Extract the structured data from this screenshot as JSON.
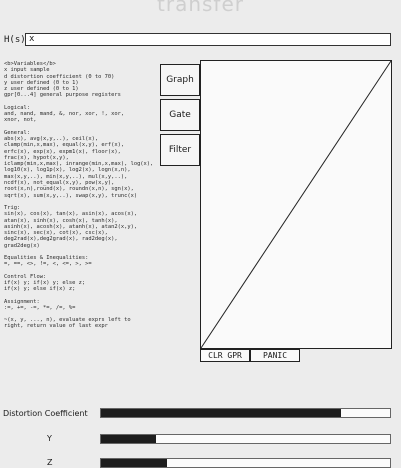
{
  "app": {
    "title": "transfer"
  },
  "expression": {
    "label": "H(s)=",
    "value": "x"
  },
  "docs": [
    {
      "lines": [
        "<b>Variables</b>",
        "x  input sample",
        "d  distortion coefficient (0 to 70)",
        "y  user defined (0 to 1)",
        "z  user defined (0 to 1)",
        "gpr[0...4]  general purpose registers"
      ]
    },
    {
      "lines": [
        "Logical:",
        "and, nand, mand, &, nor, xor, !, xor,",
        "xnor, not,"
      ]
    },
    {
      "lines": [
        "General:",
        "abs(x), avg(x,y,..), ceil(x),",
        "clamp(min,x,max), equal(x,y), erf(x),",
        "erfc(x), exp(x), expm1(x), floor(x),",
        "frac(x), hypot(x,y),",
        "iclamp(min,x,max), inrange(min,x,max), log(x),",
        "log10(x), log1p(x), log2(x), logn(x,n),",
        "max(x,y,..), min(x,y,..), mul(x,y,..),",
        "ncdf(x), not_equal(x,y), pow(x,y),",
        "root(x,n),round(x), roundn(x,n), sgn(x),",
        "sqrt(x), sum(x,y,..), swap(x,y), trunc(x)"
      ]
    },
    {
      "lines": [
        "Trig:",
        "sin(x), cos(x), tan(x), asin(x), acos(x),",
        "atan(x), sinh(x), cosh(x), tanh(x),",
        "asinh(x), acosh(x), atanh(x), atan2(x,y),",
        "sinc(x), sec(x), cot(x), csc(x),",
        "deg2rad(x),deg2grad(x), rad2deg(x),",
        "grad2deg(x)"
      ]
    },
    {
      "lines": [
        "Equalities & Inequalities:",
        "=, ==, <>, !=, <, <=, >, >="
      ]
    },
    {
      "lines": [
        "Control Flow:",
        "if(x) y;  if(x) y; else z;",
        "if(x) y; else if(x) z;"
      ]
    },
    {
      "lines": [
        "Assignment:",
        ":=, +=, -=, *=, /=, %="
      ]
    },
    {
      "lines": [
        "~(x, y, ..., n), evaluate exprs left to",
        "right, return value of last expr"
      ]
    }
  ],
  "buttons": {
    "graph": "Graph",
    "gate": "Gate",
    "filter": "Filter",
    "clr_gpr": "CLR GPR",
    "panic": "PANIC"
  },
  "plot": {
    "curve": "identity",
    "x_range": [
      -1,
      1
    ],
    "y_range": [
      -1,
      1
    ]
  },
  "sliders": [
    {
      "label": "Distortion Coefficient",
      "value": 0.83
    },
    {
      "label": "Y",
      "value": 0.19
    },
    {
      "label": "Z",
      "value": 0.23
    }
  ],
  "colors": {
    "fill": "#1d1d1d",
    "border": "#222222"
  }
}
